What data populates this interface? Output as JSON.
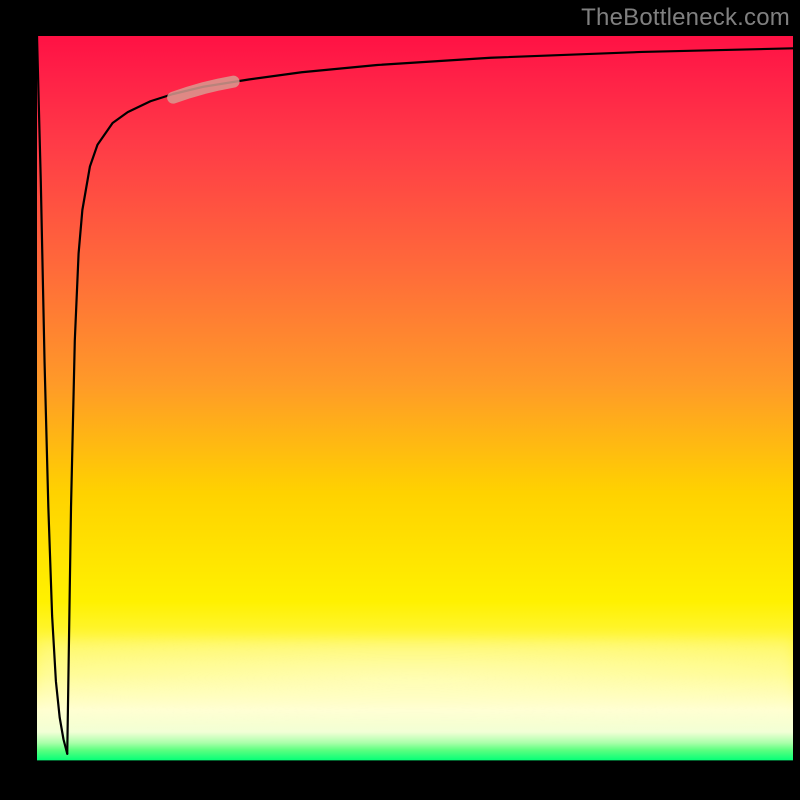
{
  "watermark": "TheBottleneck.com",
  "chart_data": {
    "type": "line",
    "title": "",
    "xlabel": "",
    "ylabel": "",
    "ylim": [
      0,
      100
    ],
    "xlim": [
      0,
      100
    ],
    "background_gradient": {
      "orientation": "vertical",
      "stops": [
        {
          "pct": 0,
          "color": "#ff1144"
        },
        {
          "pct": 15,
          "color": "#ff3b47"
        },
        {
          "pct": 32,
          "color": "#ff6a3a"
        },
        {
          "pct": 48,
          "color": "#ff9a28"
        },
        {
          "pct": 63,
          "color": "#ffd200"
        },
        {
          "pct": 78,
          "color": "#fff100"
        },
        {
          "pct": 93,
          "color": "#ffffcc"
        },
        {
          "pct": 97,
          "color": "#aaffaa"
        },
        {
          "pct": 100,
          "color": "#00ff77"
        }
      ]
    },
    "series": [
      {
        "name": "x-axis-baseline",
        "color": "#000000",
        "x": [
          0,
          100
        ],
        "values": [
          0,
          0
        ]
      },
      {
        "name": "curve-down",
        "color": "#000000",
        "x": [
          0.0,
          0.5,
          1.0,
          1.5,
          2.0,
          2.5,
          3.0,
          3.5,
          4.0
        ],
        "values": [
          100,
          80,
          55,
          35,
          20,
          11,
          6,
          3,
          1
        ]
      },
      {
        "name": "curve-up",
        "color": "#000000",
        "x": [
          4.0,
          4.5,
          5.0,
          5.5,
          6.0,
          7.0,
          8.0,
          10,
          12,
          15,
          18,
          22,
          28,
          35,
          45,
          60,
          80,
          100
        ],
        "values": [
          1,
          35,
          58,
          70,
          76,
          82,
          85,
          88,
          89.5,
          91,
          92,
          93,
          94,
          95,
          96,
          97,
          97.8,
          98.3
        ]
      }
    ],
    "highlight": {
      "name": "highlight-segment",
      "color": "#d99a90",
      "opacity": 0.85,
      "x": [
        18,
        20,
        22,
        24,
        26
      ],
      "values": [
        91.5,
        92.2,
        92.8,
        93.3,
        93.7
      ]
    }
  }
}
